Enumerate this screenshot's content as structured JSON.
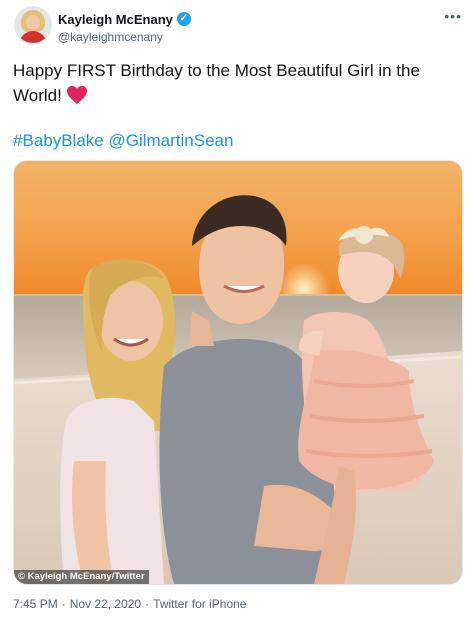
{
  "tweet": {
    "author_name": "Kayleigh McEnany",
    "author_handle": "@kayleighmcenany",
    "text": "Happy FIRST Birthday to the Most Beautiful Girl in the World!",
    "hashtag": "#BabyBlake",
    "mention": "@GilmartinSean",
    "time": "7:45 PM",
    "date": "Nov 22, 2020",
    "client": "Twitter for iPhone"
  },
  "icons": {
    "verified": "verified-badge-icon",
    "more": "more-options-icon",
    "heart": "red-heart-emoji"
  },
  "image_credit": "© Kayleigh McEnany/Twitter",
  "colors": {
    "link": "#1b95e0",
    "verified": "#1da1f2",
    "heart": "#e0245e",
    "secondary_text": "#536471"
  }
}
